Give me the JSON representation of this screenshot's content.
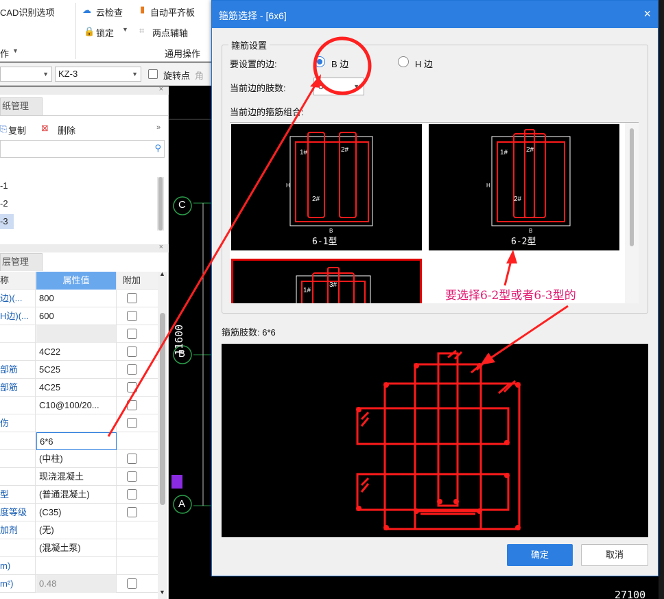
{
  "ribbon": {
    "cad_options": "CAD识别选项",
    "cloud_check": "云检查",
    "auto_align": "自动平齐板",
    "lock": "锁定",
    "two_point_axis": "两点辅轴",
    "op_label": "作",
    "general_ops": "通用操作"
  },
  "selectors": {
    "member": "KZ-3",
    "rotate_point_label": "旋转点",
    "rotate_trailing": "角"
  },
  "drawing_panel": {
    "title": "纸管理",
    "copy": "复制",
    "delete": "删除",
    "items": [
      "-1",
      "-2",
      "-3"
    ]
  },
  "layer_panel": {
    "title": "层管理"
  },
  "props": {
    "headers": {
      "name": "称",
      "value": "属性值",
      "extra": "附加"
    },
    "rows": [
      {
        "name": "边)(...",
        "value": "800",
        "check": true
      },
      {
        "name": "H边)(...",
        "value": "600",
        "check": true
      },
      {
        "name": "",
        "value": "",
        "check": true,
        "gray": true
      },
      {
        "name": "",
        "value": "4C22",
        "check": true
      },
      {
        "name": "部筋",
        "value": "5C25",
        "check": true
      },
      {
        "name": "部筋",
        "value": "4C25",
        "check": true
      },
      {
        "name": "",
        "value": "C10@100/20...",
        "check": true
      },
      {
        "name": "伤",
        "value": "",
        "check": true
      },
      {
        "name": "",
        "value": "6*6",
        "check": false,
        "active": true
      },
      {
        "name": "",
        "value": "(中柱)",
        "check": true
      },
      {
        "name": "",
        "value": "现浇混凝土",
        "check": true
      },
      {
        "name": "型",
        "value": "(普通混凝土)",
        "check": true
      },
      {
        "name": "度等级",
        "value": "(C35)",
        "check": true
      },
      {
        "name": "加剂",
        "value": "(无)",
        "check": false
      },
      {
        "name": "",
        "value": "(混凝土泵)",
        "check": false
      },
      {
        "name": "m)",
        "value": "",
        "check": false
      },
      {
        "name": "m²)",
        "value": "0.48",
        "check": true,
        "gray": true
      }
    ]
  },
  "canvas": {
    "axis_c": "C",
    "axis_b": "B",
    "axis_a": "A",
    "dim_vertical": "11600",
    "dim_bottom": "27100"
  },
  "dialog": {
    "title": "箍筋选择 - [6x6]",
    "group_title": "箍筋设置",
    "side_label": "要设置的边:",
    "side_b": "B 边",
    "side_h": "H 边",
    "count_label": "当前边的肢数:",
    "count_value": "6",
    "combo_label": "当前边的箍筋组合:",
    "options": [
      {
        "label": "6-1型"
      },
      {
        "label": "6-2型"
      },
      {
        "label": ""
      }
    ],
    "legs_label": "箍筋肢数: 6*6",
    "ok": "确定",
    "cancel": "取消"
  },
  "annotation": "要选择6-2型或者6-3型的",
  "colors": {
    "accent": "#2c7ee0",
    "rebar": "#ff1a1a",
    "annotation": "#e0176f"
  }
}
